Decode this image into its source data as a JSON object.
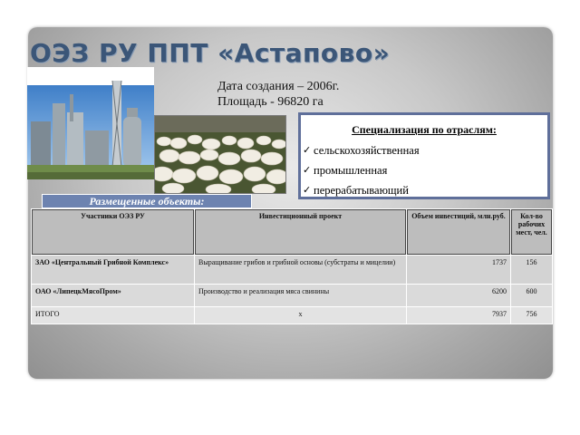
{
  "slide": {
    "title": "ОЭЗ РУ ППТ «Астапово»",
    "created": "Дата создания – 2006г.",
    "area": "Площадь - 96820 га"
  },
  "specialization": {
    "heading": "Специализация по отраслям:",
    "items": [
      "сельскохозяйственная",
      "промышленная",
      "перерабатывающий"
    ]
  },
  "placed_label": "Размещенные объекты:",
  "table": {
    "headers": {
      "participants": "Участники ОЭЗ РУ",
      "project": "Инвестиционный проект",
      "investment": "Объем инвестиций, млн.руб.",
      "jobs": "Кол-во рабочих мест, чел."
    },
    "rows": [
      {
        "participant": "ЗАО «Центральный Грибной Комплекс»",
        "project": "Выращивание грибов и грибной основы (субстраты и мицелии)",
        "investment": "1737",
        "jobs": "156"
      },
      {
        "participant": "ОАО «ЛипецкМясоПром»",
        "project": "Производство и реализация мяса свинины",
        "investment": "6200",
        "jobs": "600"
      }
    ],
    "total": {
      "label": "ИТОГО",
      "project": "x",
      "investment": "7937",
      "jobs": "756"
    }
  },
  "colors": {
    "title": "#3b5678",
    "label_bar": "#6d83b0",
    "spec_border": "#5f6f9a"
  }
}
